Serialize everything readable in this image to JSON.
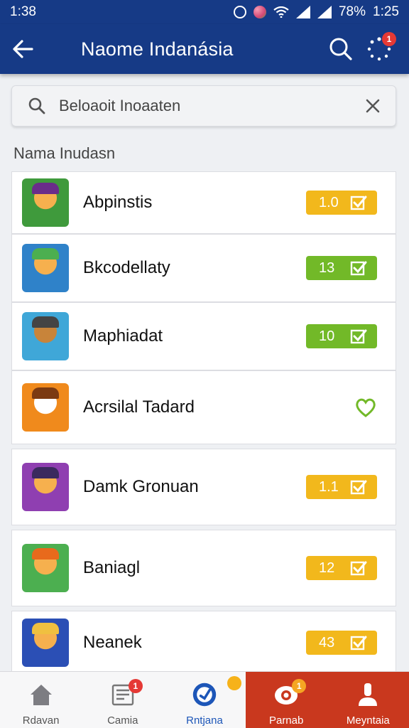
{
  "status_bar": {
    "time_left": "1:38",
    "battery": "78%",
    "clock": "1:25"
  },
  "app_bar": {
    "title": "Naome Indanásia",
    "notification_count": "1"
  },
  "search": {
    "value": "Beloaoit Inoaaten"
  },
  "section_label": "Nama Inudasn",
  "items": [
    {
      "name": "Abpinstis",
      "value": "1.0",
      "status": "yellow",
      "colors": [
        "#3f9a3c",
        "#f6b04e",
        "#6a2d8a"
      ]
    },
    {
      "name": "Bkcodellaty",
      "value": "13",
      "status": "green",
      "colors": [
        "#2f82c9",
        "#f6b04e",
        "#4caf50"
      ]
    },
    {
      "name": "Maphiadat",
      "value": "10",
      "status": "green",
      "colors": [
        "#3fa7d8",
        "#c8843a",
        "#444"
      ]
    },
    {
      "name": "Acrsilal Tadard",
      "status": "heart",
      "colors": [
        "#f08a1c",
        "#fff",
        "#7b3a12"
      ]
    },
    {
      "name": "Damk Gronuan",
      "value": "1.1",
      "status": "yellow",
      "colors": [
        "#8f3fb1",
        "#f6b04e",
        "#3b2a5e"
      ]
    },
    {
      "name": "Baniagl",
      "value": "12",
      "status": "yellow",
      "colors": [
        "#4caf50",
        "#f6b04e",
        "#e86a1c"
      ]
    },
    {
      "name": "Neanek",
      "value": "43",
      "status": "yellow",
      "colors": [
        "#2b4fb5",
        "#f6b04e",
        "#f0c040"
      ]
    }
  ],
  "bottom_nav": [
    {
      "label": "Rdavan",
      "icon": "home-icon",
      "badge": ""
    },
    {
      "label": "Camia",
      "icon": "news-icon",
      "badge": "1"
    },
    {
      "label": "Rntjana",
      "icon": "compass-icon",
      "badge": ""
    },
    {
      "label": "Parnab",
      "icon": "controller-icon",
      "badge": "1"
    },
    {
      "label": "Meyntaia",
      "icon": "profile-icon",
      "badge": ""
    }
  ],
  "colors": {
    "primary": "#163a86",
    "yellow": "#f2b81c",
    "green": "#72b928",
    "red": "#c9381e",
    "active": "#1d56b8"
  }
}
